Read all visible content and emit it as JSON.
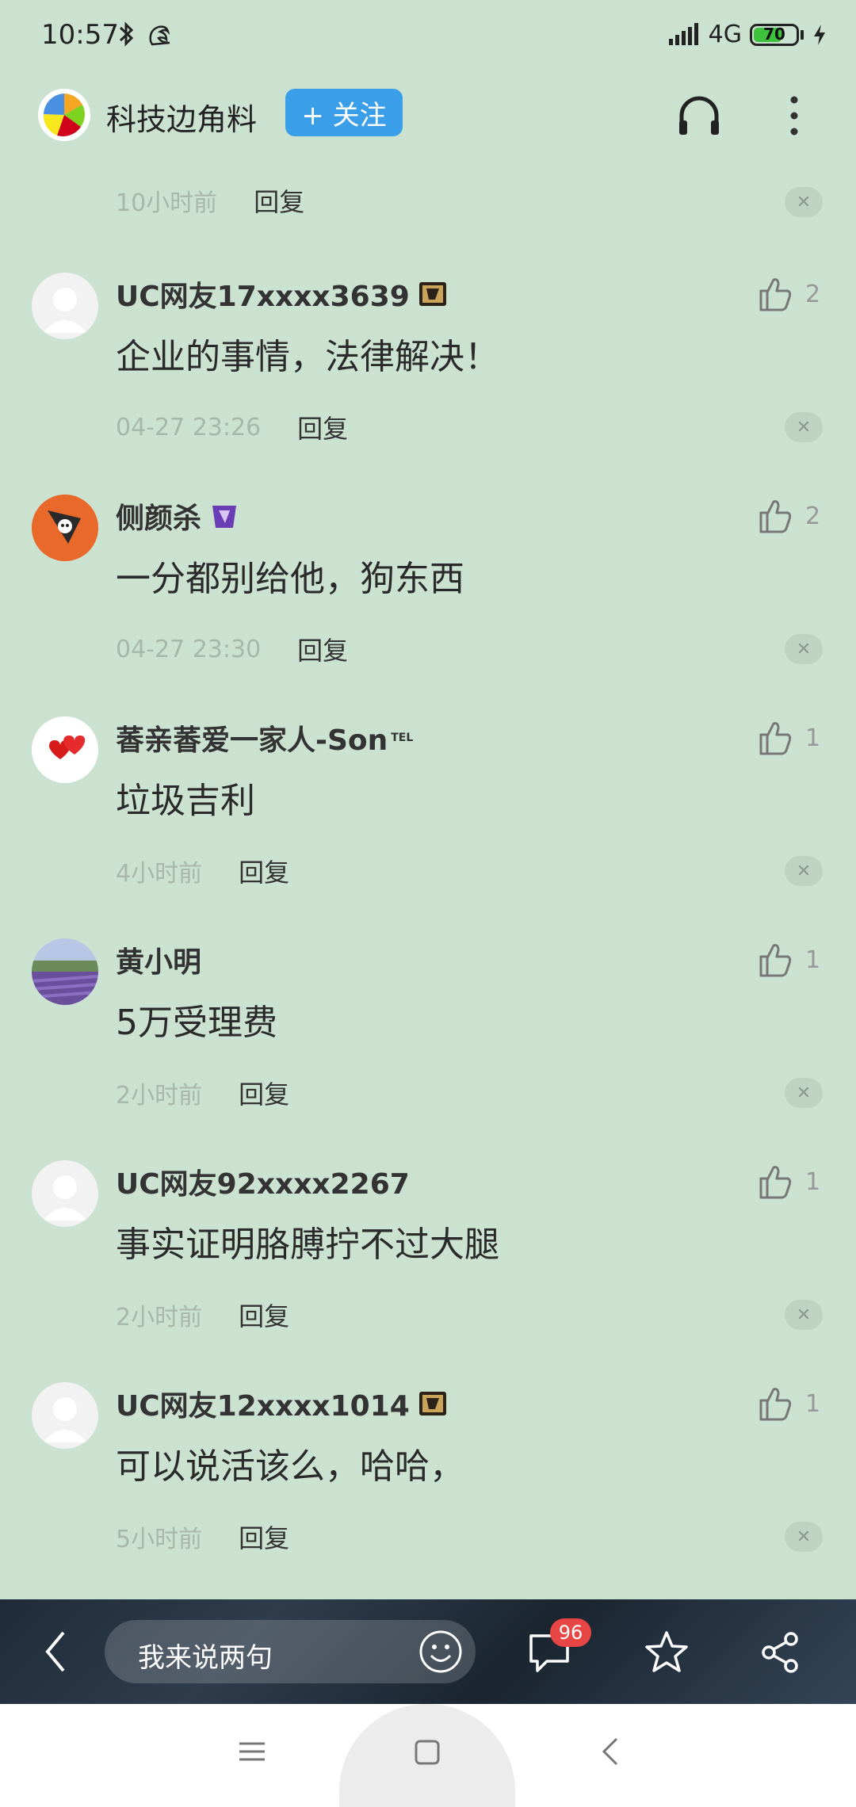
{
  "status_bar": {
    "time": "10:57",
    "network": "4G",
    "battery": "70",
    "battery_level": 0.7
  },
  "header": {
    "channel_name": "科技边角料",
    "follow_label": "+ 关注"
  },
  "top_partial": {
    "time": "10小时前",
    "reply": "回复"
  },
  "comments": [
    {
      "user": "UC网友17xxxx3639",
      "badge": "gold-badge-icon",
      "likes": "2",
      "text": "企业的事情，法律解决！",
      "time": "04-27 23:26",
      "reply": "回复",
      "avatar": "default"
    },
    {
      "user": "侧颜杀",
      "badge": "purple-badge-icon",
      "likes": "2",
      "text": "一分都别给他，狗东西",
      "time": "04-27 23:30",
      "reply": "回复",
      "avatar": "orange"
    },
    {
      "user": "萫亲萫爱一家人-Son",
      "badge_text": "TEL",
      "likes": "1",
      "text": "垃圾吉利",
      "time": "4小时前",
      "reply": "回复",
      "avatar": "hearts"
    },
    {
      "user": "黄小明",
      "likes": "1",
      "text": "5万受理费",
      "time": "2小时前",
      "reply": "回复",
      "avatar": "lavender"
    },
    {
      "user": "UC网友92xxxx2267",
      "likes": "1",
      "text": "事实证明胳膊拧不过大腿",
      "time": "2小时前",
      "reply": "回复",
      "avatar": "default"
    },
    {
      "user": "UC网友12xxxx1014",
      "badge": "gold-badge-icon",
      "likes": "1",
      "text": "可以说活该么，哈哈，",
      "time": "5小时前",
      "reply": "回复",
      "avatar": "default"
    }
  ],
  "bottom_bar": {
    "input_placeholder": "我来说两句",
    "comment_count": "96"
  },
  "colors": {
    "background": "#cce2d1",
    "follow_button": "#3a9ee8",
    "badge_red": "#e84545"
  }
}
